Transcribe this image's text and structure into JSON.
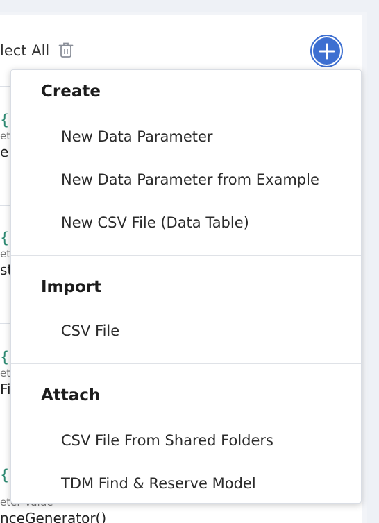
{
  "toolbar": {
    "select_all_label": "lect All",
    "add_button_symbol": "+"
  },
  "background_list": [
    {
      "name": "{D",
      "label": "ete",
      "value": "e."
    },
    {
      "name": "{E",
      "label": "ete",
      "value": "str"
    },
    {
      "name": "{F",
      "label": "ete",
      "value": "Fi"
    },
    {
      "name": "{In",
      "label": "eter Value",
      "value": "nceGenerator()"
    }
  ],
  "menu": {
    "sections": [
      {
        "heading": "Create",
        "items": [
          "New Data Parameter",
          "New Data Parameter from Example",
          "New CSV File (Data Table)"
        ]
      },
      {
        "heading": "Import",
        "items": [
          "CSV File"
        ]
      },
      {
        "heading": "Attach",
        "items": [
          "CSV File From Shared Folders",
          "TDM Find & Reserve Model"
        ]
      }
    ]
  },
  "colors": {
    "accent": "#3d6fd1",
    "parameter_name": "#2e8a72",
    "menu_border": "#d9dde4"
  },
  "icons": [
    "trash-icon",
    "plus-icon"
  ]
}
